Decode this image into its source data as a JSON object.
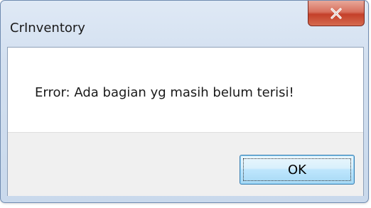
{
  "dialog": {
    "title": "CrInventory",
    "message": "Error: Ada bagian yg masih belum terisi!",
    "ok_label": "OK"
  },
  "icons": {
    "close": "close-icon"
  },
  "colors": {
    "title_bar": "#d3e0f0",
    "close_button": "#c4402a",
    "content_background": "#ffffff",
    "button_area_background": "#f0f0f0",
    "ok_button": "#bee6fd"
  }
}
